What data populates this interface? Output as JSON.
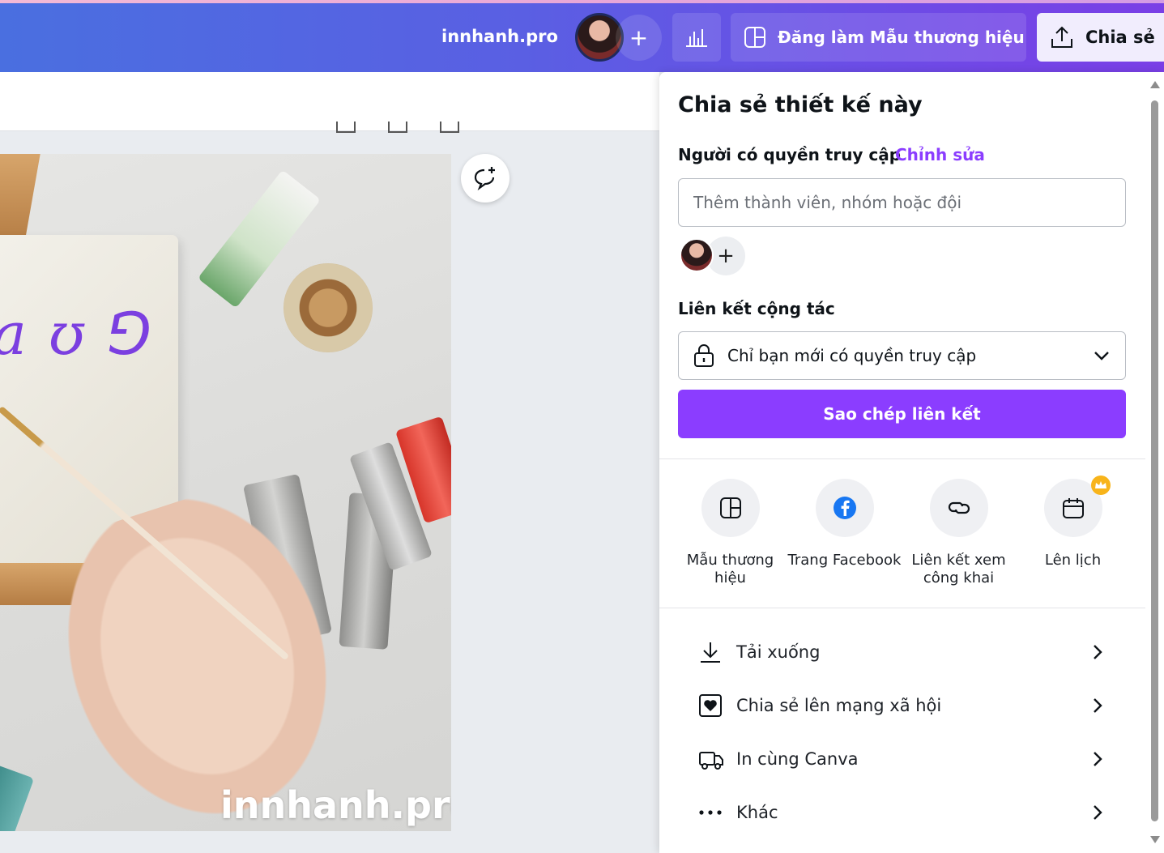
{
  "topbar": {
    "site_title": "innhanh.pro",
    "add_label": "+",
    "brand_button": "Đăng làm Mẫu thương hiệu",
    "share_button": "Chia sẻ"
  },
  "canvas": {
    "script_text": "a ʊ ⅁",
    "watermark": "innhanh.pro"
  },
  "share_panel": {
    "title": "Chia sẻ thiết kế này",
    "access_label": "Người có quyền truy cập",
    "access_edit": "Chỉnh sửa",
    "member_placeholder": "Thêm thành viên, nhóm hoặc đội",
    "add_member": "+",
    "link_label": "Liên kết cộng tác",
    "link_option": "Chỉ bạn mới có quyền truy cập",
    "copy_button": "Sao chép liên kết",
    "quick_actions": [
      {
        "label": "Mẫu thương hiệu",
        "icon": "template-icon"
      },
      {
        "label": "Trang Facebook",
        "icon": "facebook-icon"
      },
      {
        "label": "Liên kết xem công khai",
        "icon": "link-icon"
      },
      {
        "label": "Lên lịch",
        "icon": "calendar-icon"
      }
    ],
    "list": [
      {
        "label": "Tải xuống",
        "icon": "download-icon"
      },
      {
        "label": "Chia sẻ lên mạng xã hội",
        "icon": "heart-icon"
      },
      {
        "label": "In cùng Canva",
        "icon": "truck-icon"
      },
      {
        "label": "Khác",
        "icon": "more-icon"
      }
    ]
  },
  "colors": {
    "accent": "#8b3dff",
    "facebook": "#1877f2",
    "crown": "#f8b41a"
  }
}
